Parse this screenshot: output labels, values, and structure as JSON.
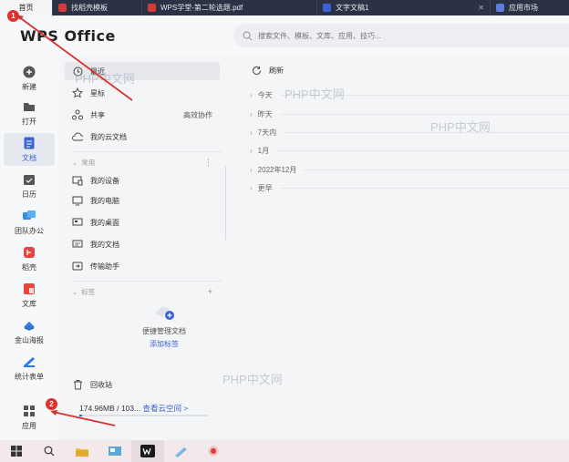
{
  "tabs": [
    {
      "label": "首页",
      "icon": "home",
      "color": ""
    },
    {
      "label": "找稻壳模板",
      "icon": "docer-icon",
      "color": "#d63b3b"
    },
    {
      "label": "WPS学堂-第二轮选题.pdf",
      "icon": "pdf-icon",
      "color": "#d63b3b"
    },
    {
      "label": "文字文稿1",
      "icon": "writer-icon",
      "color": "#3a61d6"
    },
    {
      "label": "应用市场",
      "icon": "app-market-icon",
      "color": "#3a61d6"
    }
  ],
  "header": {
    "logo_a": "WPS",
    "logo_b": "Office",
    "search_placeholder": "搜索文件、模板、文库、应用、技巧..."
  },
  "rail": {
    "items": [
      {
        "label": "新建",
        "icon": "plus-icon"
      },
      {
        "label": "打开",
        "icon": "folder-icon"
      },
      {
        "label": "文档",
        "icon": "document-icon"
      },
      {
        "label": "日历",
        "icon": "calendar-icon"
      },
      {
        "label": "团队办公",
        "icon": "team-icon"
      },
      {
        "label": "稻壳",
        "icon": "docer-icon"
      },
      {
        "label": "文库",
        "icon": "library-icon"
      },
      {
        "label": "金山海报",
        "icon": "poster-icon"
      },
      {
        "label": "统计表单",
        "icon": "form-icon"
      },
      {
        "label": "应用",
        "icon": "apps-grid-icon"
      }
    ],
    "active_index": 2
  },
  "nav2": {
    "top_items": [
      {
        "label": "最近",
        "icon": "clock-icon"
      },
      {
        "label": "星标",
        "icon": "star-icon"
      },
      {
        "label": "共享",
        "icon": "share-icon",
        "right": "高效协作"
      },
      {
        "label": "我的云文档",
        "icon": "cloud-icon"
      }
    ],
    "common_header": "常用",
    "common_items": [
      {
        "label": "我的设备",
        "icon": "device-icon"
      },
      {
        "label": "我的电脑",
        "icon": "computer-icon"
      },
      {
        "label": "我的桌面",
        "icon": "desktop-icon"
      },
      {
        "label": "我的文档",
        "icon": "mydocs-icon"
      },
      {
        "label": "传输助手",
        "icon": "transfer-icon"
      }
    ],
    "tags_header": "标签",
    "tags_empty_text": "便捷管理文档",
    "tags_add_link": "添加标签",
    "recycle": "回收站",
    "storage_text": "174.96MB / 103...",
    "storage_link": "查看云空间 >",
    "storage_fraction": 0.02
  },
  "main": {
    "refresh_label": "刷新",
    "groups": [
      "今天",
      "昨天",
      "7天内",
      "1月",
      "2022年12月",
      "更早"
    ]
  },
  "watermark": "PHP中文网",
  "annotations": [
    "1",
    "2"
  ],
  "taskbar": {
    "items": [
      "windows-start-icon",
      "search-icon",
      "file-explorer-icon",
      "control-panel-icon",
      "wps-icon",
      "notes-icon",
      "screen-recorder-icon"
    ]
  },
  "colors": {
    "accent": "#3a61d6",
    "badge": "#e03131",
    "tabbar": "#2b3245"
  }
}
